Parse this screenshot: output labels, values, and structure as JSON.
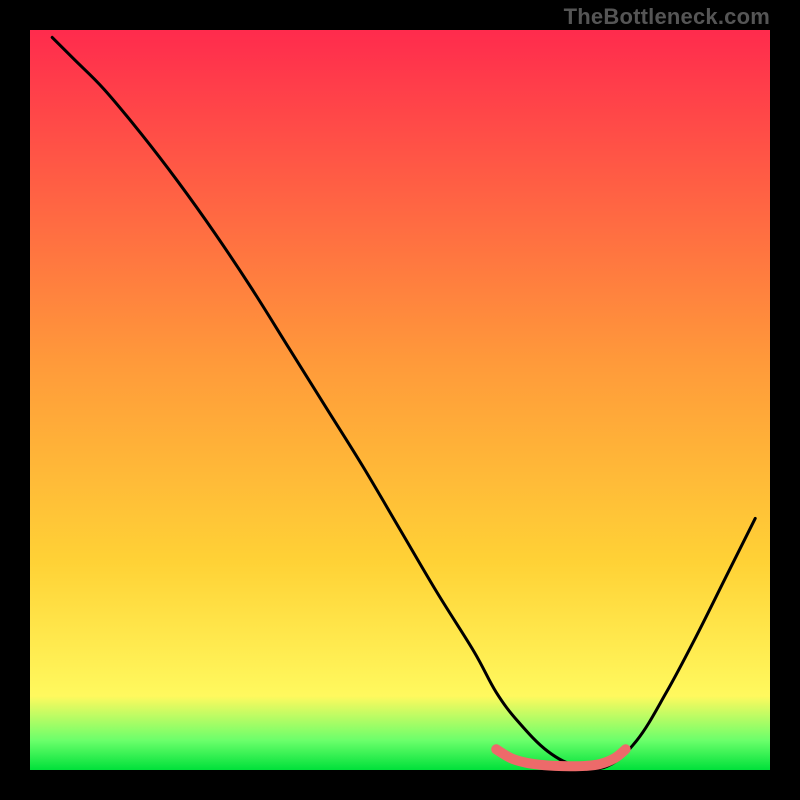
{
  "watermark": "TheBottleneck.com",
  "chart_data": {
    "type": "line",
    "title": "",
    "xlabel": "",
    "ylabel": "",
    "xlim": [
      0,
      100
    ],
    "ylim": [
      0,
      100
    ],
    "grid": false,
    "legend": false,
    "background_gradient": {
      "top_color": "#ff2b4d",
      "mid_color": "#ffd236",
      "bottom_color_1": "#fff95e",
      "bottom_color_2": "#6bff6b",
      "bottom_color_3": "#00e13a"
    },
    "series": [
      {
        "name": "bottleneck-curve",
        "color": "#000000",
        "x": [
          3,
          6,
          10,
          15,
          20,
          25,
          30,
          35,
          40,
          45,
          50,
          55,
          60,
          63,
          66,
          70,
          74,
          78,
          82,
          86,
          90,
          94,
          98
        ],
        "y": [
          99,
          96,
          92,
          86,
          79.5,
          72.5,
          65,
          57,
          49,
          41,
          32.5,
          24,
          16,
          10.5,
          6.5,
          2.5,
          0.5,
          0.5,
          4,
          10.5,
          18,
          26,
          34
        ]
      },
      {
        "name": "optimal-zone-marker",
        "color": "#ed6a6a",
        "x": [
          63,
          65,
          67,
          69,
          71,
          73,
          75,
          77,
          79,
          80.5
        ],
        "y": [
          2.8,
          1.6,
          1.0,
          0.7,
          0.55,
          0.5,
          0.55,
          0.8,
          1.6,
          2.8
        ]
      }
    ],
    "annotations": []
  }
}
